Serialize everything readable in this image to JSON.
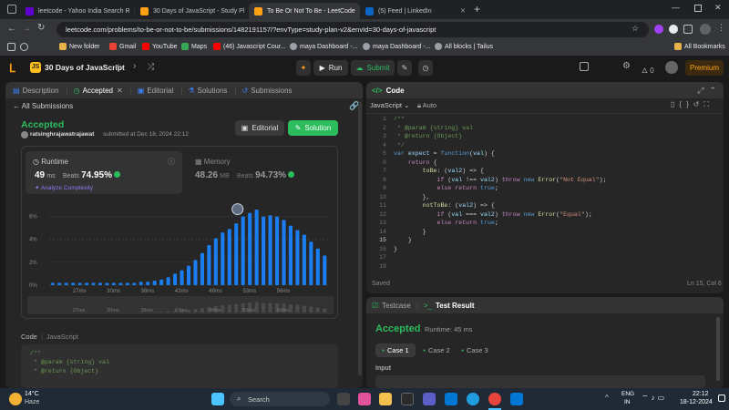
{
  "browser": {
    "tabs": [
      {
        "title": "leetcode - Yahoo India Search R",
        "color": "#6001d2"
      },
      {
        "title": "30 Days of JavaScript - Study Pl",
        "color": "#ffa116"
      },
      {
        "title": "To Be Or Not To Be - LeetCode",
        "color": "#ffa116"
      },
      {
        "title": "(5) Feed | LinkedIn",
        "color": "#0a66c2"
      }
    ],
    "url": "leetcode.com/problems/to-be-or-not-to-be/submissions/1482191157/?envType=study-plan-v2&envId=30-days-of-javascript",
    "bookmarks": [
      {
        "label": "New folder",
        "color": "#e8b14a"
      },
      {
        "label": "Gmail",
        "color": "#ea4335"
      },
      {
        "label": "YouTube",
        "color": "#ff0000"
      },
      {
        "label": "Maps",
        "color": "#34a853"
      },
      {
        "label": "(46) Javascript Cour...",
        "color": "#ff0000"
      },
      {
        "label": "maya Dashboard -...",
        "color": "#e8eaed"
      },
      {
        "label": "maya Dashboard -...",
        "color": "#e8eaed"
      },
      {
        "label": "All blocks | Tailus",
        "color": "#e8eaed"
      }
    ],
    "all_bookmarks": "All Bookmarks"
  },
  "nav": {
    "study_plan": "30 Days of JavaScript",
    "run": "Run",
    "submit": "Submit",
    "streak": "0",
    "premium": "Premium"
  },
  "left_tabs": [
    "Description",
    "Accepted",
    "Editorial",
    "Solutions",
    "Submissions"
  ],
  "submission": {
    "back": "All Submissions",
    "status": "Accepted",
    "user": "ratsinghrajawatrajawat",
    "submitted": "submitted at Dec 18, 2024 22:12",
    "editorial_btn": "Editorial",
    "solution_btn": "Solution",
    "runtime_label": "Runtime",
    "runtime_value": "49",
    "runtime_unit": "ms",
    "beats_label": "Beats",
    "runtime_beats": "74.95%",
    "analyze": "Analyze Complexity",
    "memory_label": "Memory",
    "memory_value": "48.26",
    "memory_unit": "MB",
    "memory_beats": "94.73%",
    "code_label": "Code",
    "lang": "JavaScript"
  },
  "chart_data": {
    "type": "bar",
    "yticks": [
      "6%",
      "4%",
      "2%",
      "0%"
    ],
    "xticks": [
      "27ms",
      "30ms",
      "38ms",
      "43ms",
      "48ms",
      "53ms",
      "56ms"
    ],
    "ylim": [
      0,
      7
    ],
    "values": [
      0.2,
      0.2,
      0.2,
      0.2,
      0.2,
      0.2,
      0.2,
      0.2,
      0.2,
      0.2,
      0.2,
      0.2,
      0.2,
      0.3,
      0.3,
      0.4,
      0.5,
      0.7,
      1.0,
      1.3,
      1.7,
      2.2,
      2.8,
      3.5,
      4.1,
      4.6,
      4.9,
      5.4,
      6.0,
      6.3,
      6.6,
      6.0,
      6.1,
      6.0,
      5.7,
      5.2,
      4.8,
      4.4,
      3.8,
      3.2,
      2.6
    ],
    "highlight_index": 28,
    "color": "#1a7ef2"
  },
  "left_code": [
    "/**",
    " * @param {string} val",
    " * @return {Object}"
  ],
  "editor": {
    "title": "Code",
    "lang": "JavaScript",
    "mode": "Auto",
    "saved": "Saved",
    "position": "Ln 15, Col 6",
    "line_numbers": [
      "1",
      "2",
      "3",
      "4",
      "5",
      "6",
      "7",
      "8",
      "9",
      "10",
      "11",
      "12",
      "13",
      "14",
      "15",
      "16",
      "17",
      "18"
    ]
  },
  "results": {
    "tab_testcase": "Testcase",
    "tab_result": "Test Result",
    "status": "Accepted",
    "runtime": "Runtime: 45 ms",
    "cases": [
      "Case 1",
      "Case 2",
      "Case 3"
    ],
    "input_label": "Input"
  },
  "taskbar": {
    "temp": "14°C",
    "weather": "Haze",
    "search": "Search",
    "lang": "ENG",
    "region": "IN",
    "time": "22:12",
    "date": "18-12-2024"
  }
}
